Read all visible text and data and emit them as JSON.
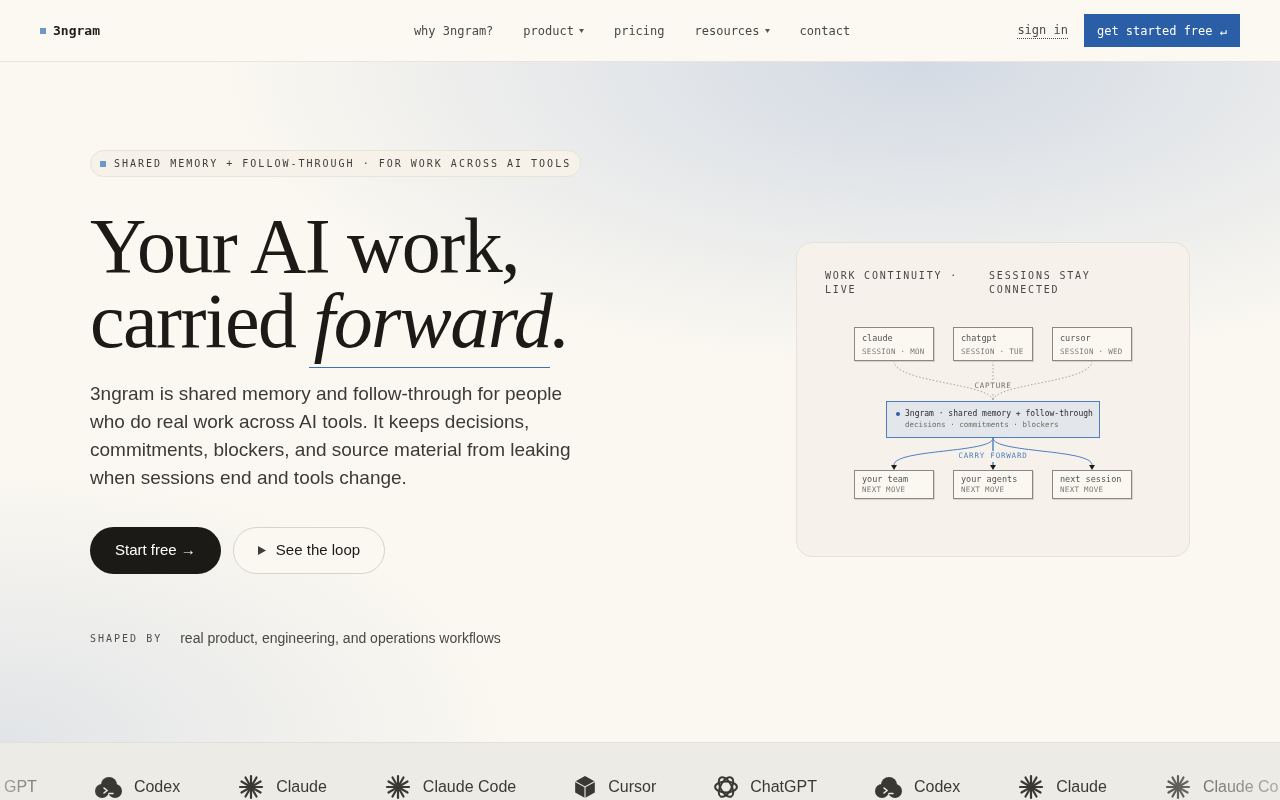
{
  "nav": {
    "logo": "3ngram",
    "links": [
      {
        "label": "why 3ngram?",
        "dropdown": false
      },
      {
        "label": "product",
        "dropdown": true
      },
      {
        "label": "pricing",
        "dropdown": false
      },
      {
        "label": "resources",
        "dropdown": true
      },
      {
        "label": "contact",
        "dropdown": false
      }
    ],
    "sign_in": "sign in",
    "cta": "get started free ↵"
  },
  "hero": {
    "eyebrow": "SHARED MEMORY + FOLLOW-THROUGH · FOR WORK ACROSS AI TOOLS",
    "heading": {
      "line_1": "Your AI work,",
      "line_2": "carried",
      "emphasis": "forward."
    },
    "body": "3ngram is shared memory and follow-through for people who do real work across AI tools. It keeps decisions, commitments, blockers, and source material from leaking when sessions end and tools change.",
    "buttons": [
      {
        "label": "Start free →",
        "kind": "primary"
      },
      {
        "label": "See the loop",
        "kind": "secondary"
      }
    ],
    "shaped_by": {
      "label": "SHAPED BY",
      "text": "real product, engineering, and operations workflows"
    }
  },
  "card": {
    "header": [
      "WORK CONTINUITY · LIVE",
      "SESSIONS STAY CONNECTED"
    ],
    "sources": [
      {
        "name": "claude",
        "meta": "SESSION · MON"
      },
      {
        "name": "chatgpt",
        "meta": "SESSION · TUE"
      },
      {
        "name": "cursor",
        "meta": "SESSION · WED"
      }
    ],
    "capture_label": "CAPTURE",
    "hub": {
      "title": "3ngram · shared memory + follow-through",
      "subtitle": "decisions · commitments · blockers"
    },
    "carry_label": "CARRY FORWARD",
    "targets": [
      {
        "name": "your team",
        "meta": "NEXT MOVE"
      },
      {
        "name": "your agents",
        "meta": "NEXT MOVE"
      },
      {
        "name": "next session",
        "meta": "NEXT MOVE"
      }
    ]
  },
  "logo_strip": [
    {
      "name": "GPT"
    },
    {
      "name": "Codex",
      "kind": "cloud"
    },
    {
      "name": "Claude",
      "kind": "burst"
    },
    {
      "name": "Claude Code",
      "kind": "burst"
    },
    {
      "name": "Cursor",
      "kind": "cube"
    },
    {
      "name": "ChatGPT",
      "kind": "knot"
    },
    {
      "name": "Codex",
      "kind": "cloud"
    },
    {
      "name": "Claude",
      "kind": "burst"
    },
    {
      "name": "Claude Co",
      "kind": "burst"
    }
  ]
}
